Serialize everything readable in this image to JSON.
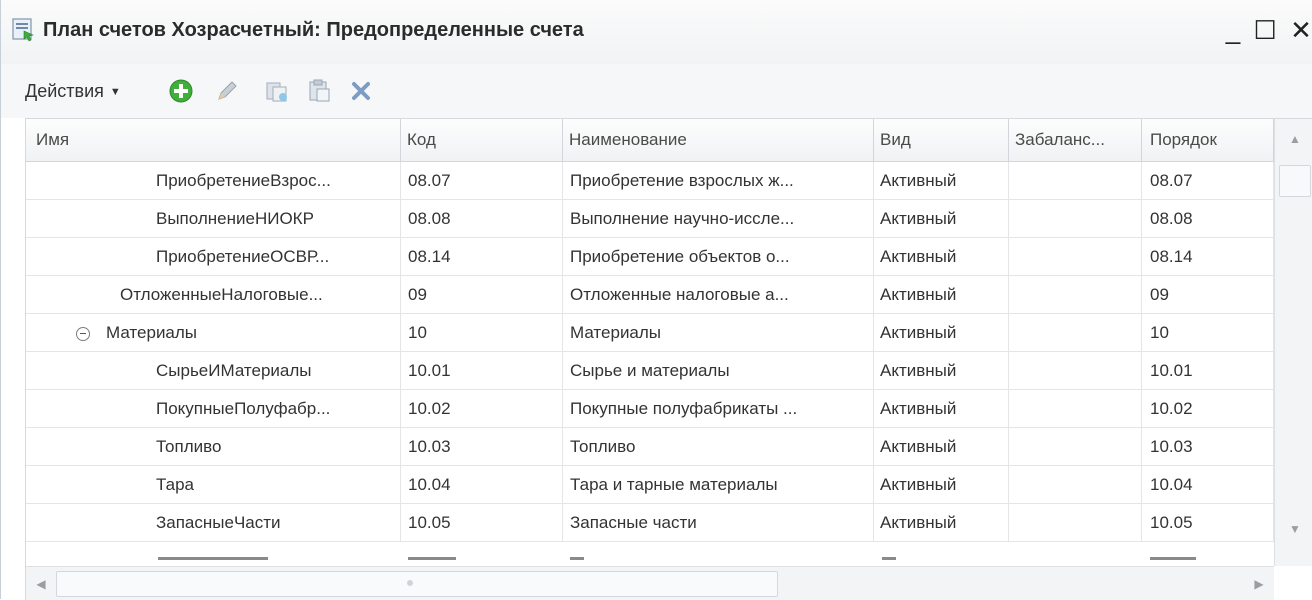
{
  "window": {
    "title": "План счетов Хозрасчетный: Предопределенные счета",
    "minimize": "_",
    "maximize": "☐",
    "close": "✕"
  },
  "toolbar": {
    "actions_label": "Действия",
    "icons": [
      "add-icon",
      "edit-icon",
      "copy-icon",
      "paste-folder-icon",
      "delete-icon"
    ]
  },
  "columns": [
    "Имя",
    "Код",
    "Наименование",
    "Вид",
    "Забаланс...",
    "Порядок"
  ],
  "rows": [
    {
      "name": "ПриобретениеВзрос...",
      "code": "08.07",
      "title": "Приобретение взрослых ж...",
      "kind": "Активный",
      "off": "",
      "order": "08.07",
      "level": 2
    },
    {
      "name": "ВыполнениеНИОКР",
      "code": "08.08",
      "title": "Выполнение научно-иссле...",
      "kind": "Активный",
      "off": "",
      "order": "08.08",
      "level": 2
    },
    {
      "name": "ПриобретениеОСВР...",
      "code": "08.14",
      "title": "Приобретение объектов о...",
      "kind": "Активный",
      "off": "",
      "order": "08.14",
      "level": 2
    },
    {
      "name": "ОтложенныеНалоговые...",
      "code": "09",
      "title": "Отложенные налоговые а...",
      "kind": "Активный",
      "off": "",
      "order": "09",
      "level": 1
    },
    {
      "name": "Материалы",
      "code": "10",
      "title": "Материалы",
      "kind": "Активный",
      "off": "",
      "order": "10",
      "level": 0,
      "expanded": true
    },
    {
      "name": "СырьеИМатериалы",
      "code": "10.01",
      "title": "Сырье и материалы",
      "kind": "Активный",
      "off": "",
      "order": "10.01",
      "level": 2
    },
    {
      "name": "ПокупныеПолуфабр...",
      "code": "10.02",
      "title": "Покупные полуфабрикаты ...",
      "kind": "Активный",
      "off": "",
      "order": "10.02",
      "level": 2
    },
    {
      "name": "Топливо",
      "code": "10.03",
      "title": "Топливо",
      "kind": "Активный",
      "off": "",
      "order": "10.03",
      "level": 2
    },
    {
      "name": "Тара",
      "code": "10.04",
      "title": "Тара и тарные материалы",
      "kind": "Активный",
      "off": "",
      "order": "10.04",
      "level": 2
    },
    {
      "name": "ЗапасныеЧасти",
      "code": "10.05",
      "title": "Запасные части",
      "kind": "Активный",
      "off": "",
      "order": "10.05",
      "level": 2
    }
  ],
  "colors": {
    "accent_green": "#3fae3a",
    "delete_blue": "#6c8fb8"
  }
}
